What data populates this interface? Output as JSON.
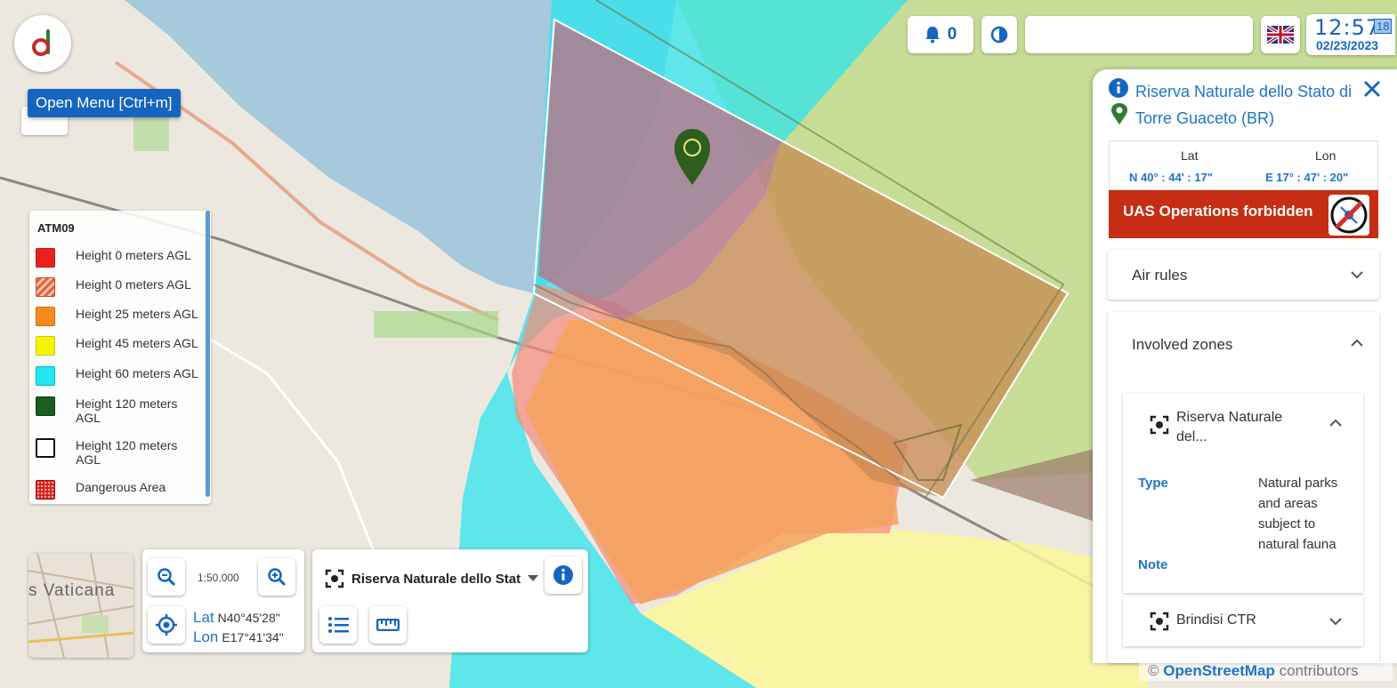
{
  "header": {
    "menu_tooltip": "Open Menu [Ctrl+m]",
    "notifications_count": "0",
    "search_value": "",
    "clock": {
      "time": "12:57",
      "seconds": "18",
      "date": "02/23/2023"
    }
  },
  "legend": {
    "title": "ATM09",
    "items": [
      {
        "label": "Height 0 meters AGL",
        "color": "#e8211c",
        "style": "solid"
      },
      {
        "label": "Height 0 meters AGL",
        "color": "#e87a55",
        "style": "hatched"
      },
      {
        "label": "Height 25 meters AGL",
        "color": "#f68a1e",
        "style": "solid"
      },
      {
        "label": "Height 45 meters AGL",
        "color": "#f5f500",
        "style": "solid"
      },
      {
        "label": "Height 60 meters AGL",
        "color": "#23e6f0",
        "style": "solid"
      },
      {
        "label": "Height 120 meters AGL",
        "color": "#1b5e20",
        "style": "solid"
      },
      {
        "label": "Height 120 meters AGL",
        "color": "#ffffff",
        "style": "outline"
      },
      {
        "label": "Dangerous Area",
        "color": "#d91a1a",
        "style": "dotted"
      }
    ]
  },
  "map_labels": {
    "minimap_text": "s Vaticana",
    "scale": "1:50,000",
    "lat_key": "Lat",
    "lat_value": "N40°45'28\"",
    "lon_key": "Lon",
    "lon_value": "E17°41'34\""
  },
  "zone_selector": {
    "selected": "Riserva Naturale dello Stat"
  },
  "info_panel": {
    "title_line1": "Riserva Naturale dello Stato di",
    "title_line2": "Torre Guaceto (BR)",
    "lat_header": "Lat",
    "lon_header": "Lon",
    "lat_value": "N 40° : 44' : 17\"",
    "lon_value": "E 17° : 47' : 20\"",
    "status": "UAS Operations forbidden",
    "status_color": "#c62d12",
    "air_rules_label": "Air rules",
    "involved_zones_label": "Involved zones",
    "zones": [
      {
        "name": "Riserva Naturale del...",
        "type_key": "Type",
        "type_value": "Natural parks and areas subject to natural fauna",
        "note_key": "Note"
      },
      {
        "name": "Brindisi CTR"
      }
    ]
  },
  "attribution": {
    "symbol": "©",
    "link": "OpenStreetMap",
    "suffix": " contributors"
  },
  "colors": {
    "accent": "#1f74c8",
    "brand_red": "#c62d12",
    "brand_green": "#2e5e1e"
  }
}
